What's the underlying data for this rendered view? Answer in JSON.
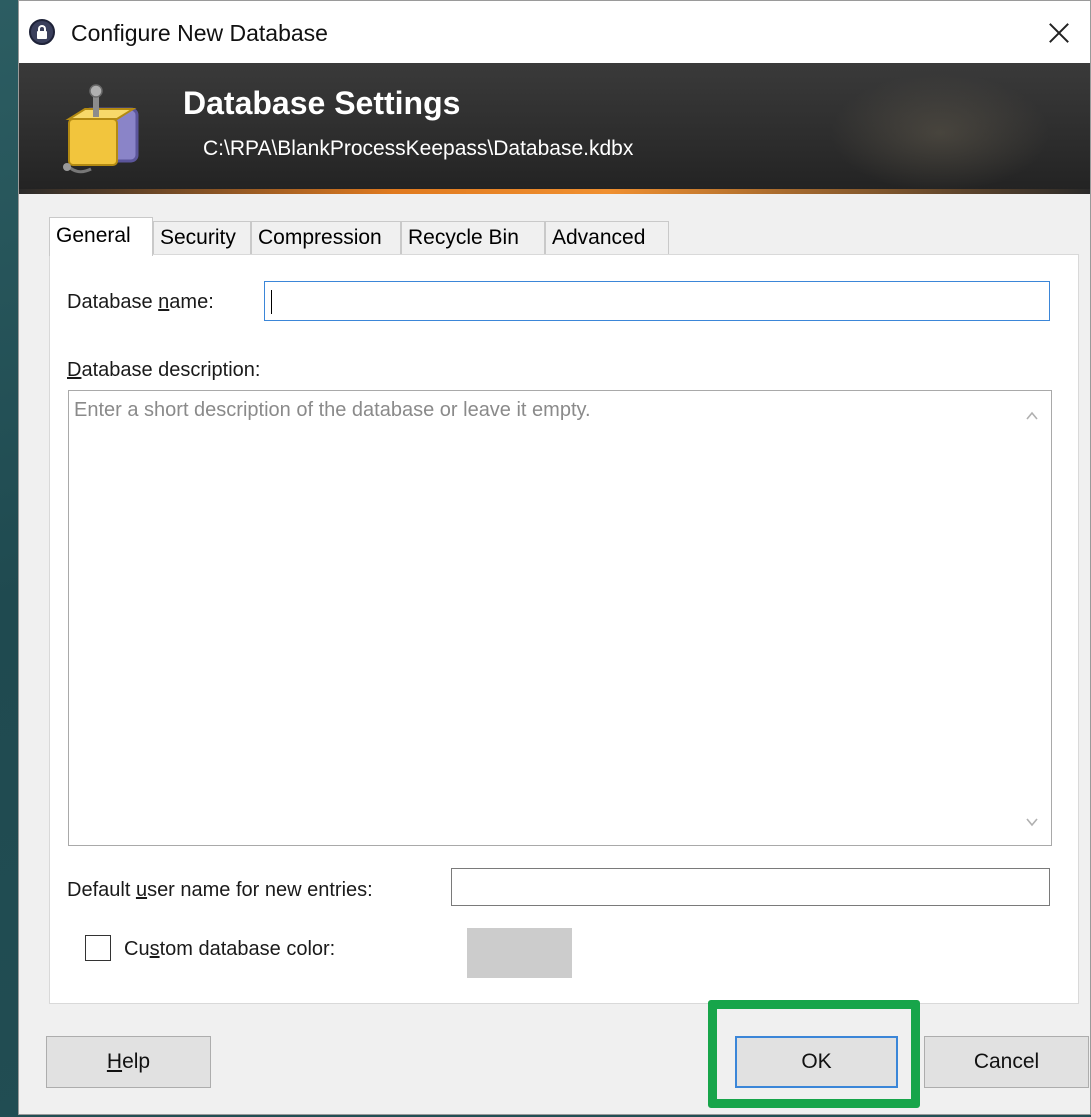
{
  "window": {
    "title": "Configure New Database",
    "close_label": "Close"
  },
  "banner": {
    "title": "Database Settings",
    "path": "C:\\RPA\\BlankProcessKeepass\\Database.kdbx"
  },
  "tabs": [
    {
      "label": "General",
      "active": true
    },
    {
      "label": "Security",
      "active": false
    },
    {
      "label": "Compression",
      "active": false
    },
    {
      "label": "Recycle Bin",
      "active": false
    },
    {
      "label": "Advanced",
      "active": false
    }
  ],
  "general": {
    "database_name_label_pre": "Database ",
    "database_name_label_u": "n",
    "database_name_label_post": "ame:",
    "database_name_value": "",
    "description_label_u": "D",
    "description_label_post": "atabase description:",
    "description_placeholder": "Enter a short description of the database or leave it empty.",
    "default_user_label_pre": "Default ",
    "default_user_label_u": "u",
    "default_user_label_post": "ser name for new entries:",
    "default_user_value": "",
    "custom_color_label_pre": "Cu",
    "custom_color_label_u": "s",
    "custom_color_label_post": "tom database color:",
    "custom_color_checked": false,
    "swatch_color": "#cccccc"
  },
  "buttons": {
    "help_u": "H",
    "help_post": "elp",
    "ok": "OK",
    "cancel": "Cancel"
  },
  "highlight_color": "#17a54a",
  "icons": [
    "lock-icon",
    "close-icon",
    "database-settings-icon",
    "chevron-up-icon",
    "chevron-down-icon"
  ]
}
